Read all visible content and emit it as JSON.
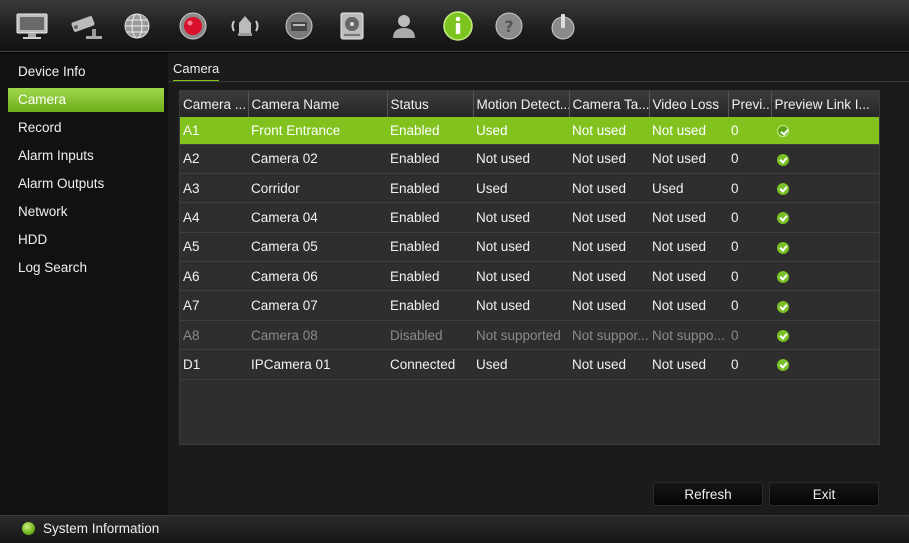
{
  "toolbar": {
    "icons": [
      "monitor-icon",
      "ptz-camera-icon",
      "network-globe-icon",
      "record-icon",
      "alarm-icon",
      "device-icon",
      "hdd-icon",
      "user-icon",
      "info-icon",
      "help-icon",
      "power-icon"
    ],
    "active": "info-icon"
  },
  "sidebar": {
    "items": [
      {
        "label": "Device Info"
      },
      {
        "label": "Camera"
      },
      {
        "label": "Record"
      },
      {
        "label": "Alarm Inputs"
      },
      {
        "label": "Alarm Outputs"
      },
      {
        "label": "Network"
      },
      {
        "label": "HDD"
      },
      {
        "label": "Log Search"
      }
    ],
    "active_index": 1
  },
  "main": {
    "tab_label": "Camera",
    "columns": [
      "Camera ...",
      "Camera Name",
      "Status",
      "Motion Detect...",
      "Camera Ta...",
      "Video Loss",
      "Previ...",
      "Preview Link I..."
    ],
    "rows": [
      {
        "id": "A1",
        "name": "Front Entrance",
        "status": "Enabled",
        "motion": "Used",
        "tamper": "Not used",
        "video_loss": "Not used",
        "preview": "0",
        "selected": true
      },
      {
        "id": "A2",
        "name": "Camera 02",
        "status": "Enabled",
        "motion": "Not used",
        "tamper": "Not used",
        "video_loss": "Not used",
        "preview": "0"
      },
      {
        "id": "A3",
        "name": "Corridor",
        "status": "Enabled",
        "motion": "Used",
        "tamper": "Not used",
        "video_loss": "Used",
        "preview": "0"
      },
      {
        "id": "A4",
        "name": "Camera 04",
        "status": "Enabled",
        "motion": "Not used",
        "tamper": "Not used",
        "video_loss": "Not used",
        "preview": "0"
      },
      {
        "id": "A5",
        "name": "Camera 05",
        "status": "Enabled",
        "motion": "Not used",
        "tamper": "Not used",
        "video_loss": "Not used",
        "preview": "0"
      },
      {
        "id": "A6",
        "name": "Camera 06",
        "status": "Enabled",
        "motion": "Not used",
        "tamper": "Not used",
        "video_loss": "Not used",
        "preview": "0"
      },
      {
        "id": "A7",
        "name": "Camera 07",
        "status": "Enabled",
        "motion": "Not used",
        "tamper": "Not used",
        "video_loss": "Not used",
        "preview": "0"
      },
      {
        "id": "A8",
        "name": "Camera 08",
        "status": "Disabled",
        "motion": "Not supported",
        "tamper": "Not suppor...",
        "video_loss": "Not suppo...",
        "preview": "0",
        "disabled": true
      },
      {
        "id": "D1",
        "name": "IPCamera 01",
        "status": "Connected",
        "motion": "Used",
        "tamper": "Not used",
        "video_loss": "Not used",
        "preview": "0"
      }
    ],
    "refresh_label": "Refresh",
    "exit_label": "Exit"
  },
  "statusbar": {
    "text": "System Information"
  },
  "colors": {
    "accent": "#82c21e",
    "background": "#1b1b1b",
    "record": "#d9102b"
  }
}
